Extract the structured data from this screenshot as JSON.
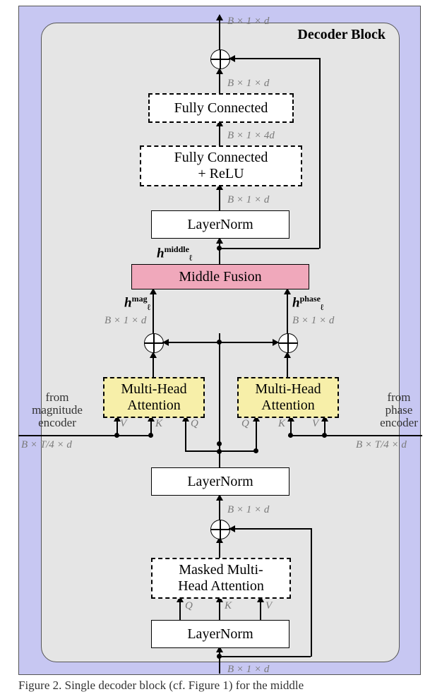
{
  "title": "Decoder Block",
  "blocks": {
    "fc_top": "Fully Connected",
    "fc_relu": "Fully Connected\n+ ReLU",
    "ln_top": "LayerNorm",
    "middle": "Middle Fusion",
    "mha_left": "Multi-Head\nAttention",
    "mha_right": "Multi-Head\nAttention",
    "ln_mid": "LayerNorm",
    "masked": "Masked Multi-\nHead Attention",
    "ln_bot": "LayerNorm"
  },
  "dims": {
    "top_out": "B × 1 × d",
    "after_fc": "B × 1 × d",
    "after_fcrelu": "B × 1 × 4d",
    "after_lntop": "B × 1 × d",
    "left_mid": "B × 1 × d",
    "right_mid": "B × 1 × d",
    "enc_left": "B × T/4 × d",
    "enc_right": "B × T/4 × d",
    "after_lnmid": "B × 1 × d",
    "bottom_in": "B × 1 × d"
  },
  "hlabels": {
    "hmag": "h",
    "hmag_sup": "mag",
    "hmag_sub": "ℓ",
    "hphase": "h",
    "hphase_sup": "phase",
    "hphase_sub": "ℓ",
    "hmid": "h",
    "hmid_sup": "middle",
    "hmid_sub": "ℓ"
  },
  "side_labels": {
    "left1": "from",
    "left2": "magnitude",
    "left3": "encoder",
    "right1": "from",
    "right2": "phase",
    "right3": "encoder"
  },
  "kvq": {
    "Q": "Q",
    "K": "K",
    "V": "V"
  },
  "caption": "Figure 2.  Single decoder block (cf. Figure 1) for the middle"
}
